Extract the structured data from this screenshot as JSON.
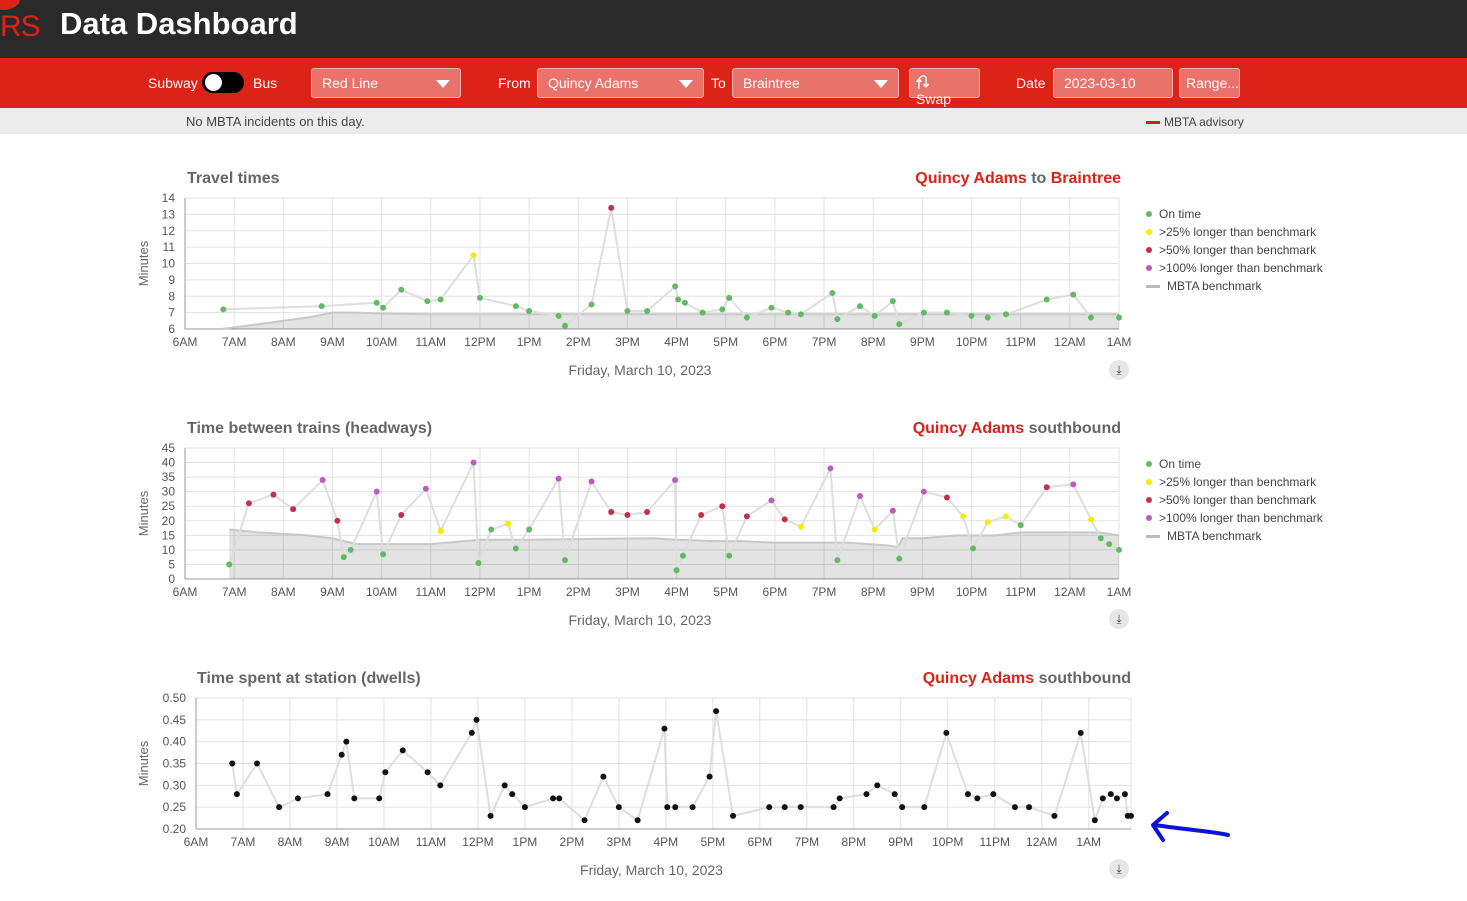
{
  "header": {
    "logo_text": "RS",
    "title": "Data Dashboard"
  },
  "controls": {
    "subway_label": "Subway",
    "bus_label": "Bus",
    "line": "Red Line",
    "from_label": "From",
    "from_value": "Quincy Adams",
    "to_label": "To",
    "to_value": "Braintree",
    "swap_label": "Swap",
    "date_label": "Date",
    "date_value": "2023-03-10",
    "range_label": "Range..."
  },
  "infobar": {
    "message": "No MBTA incidents on this day.",
    "advisory": "MBTA advisory"
  },
  "colors": {
    "accent": "#dd2218",
    "on_time": "#64b964",
    "over25": "#f5ed00",
    "over50": "#c33149",
    "over100": "#bb5cc3",
    "benchmark": "#bbbbbb"
  },
  "legend": [
    "On time",
    ">25% longer than benchmark",
    ">50% longer than benchmark",
    ">100% longer than benchmark",
    "MBTA benchmark"
  ],
  "chart_data": [
    {
      "type": "scatter",
      "title": "Travel times",
      "station_from": "Quincy Adams",
      "connector": "to",
      "station_to": "Braintree",
      "xlabel": "Friday, March 10, 2023",
      "ylabel": "Minutes",
      "x_ticks": [
        "6AM",
        "7AM",
        "8AM",
        "9AM",
        "10AM",
        "11AM",
        "12PM",
        "1PM",
        "2PM",
        "3PM",
        "4PM",
        "5PM",
        "6PM",
        "7PM",
        "8PM",
        "9PM",
        "10PM",
        "11PM",
        "12AM",
        "1AM"
      ],
      "x_range_hours": [
        6,
        25
      ],
      "y_ticks": [
        6,
        7,
        8,
        9,
        10,
        11,
        12,
        13,
        14
      ],
      "ylim": [
        6,
        14
      ],
      "benchmark": [
        [
          6.75,
          6
        ],
        [
          7.5,
          6.3
        ],
        [
          8.5,
          6.7
        ],
        [
          9.0,
          7.0
        ],
        [
          9.5,
          7.0
        ],
        [
          10,
          6.95
        ],
        [
          11,
          6.9
        ],
        [
          14,
          6.9
        ],
        [
          18,
          6.9
        ],
        [
          22,
          6.9
        ],
        [
          25,
          6.9
        ]
      ],
      "points": [
        [
          6.78,
          7.2,
          "on"
        ],
        [
          8.78,
          7.4,
          "on"
        ],
        [
          9.9,
          7.6,
          "on"
        ],
        [
          10.03,
          7.3,
          "on"
        ],
        [
          10.4,
          8.4,
          "on"
        ],
        [
          10.93,
          7.7,
          "on"
        ],
        [
          11.2,
          7.8,
          "on"
        ],
        [
          11.87,
          10.5,
          "y"
        ],
        [
          12.0,
          7.9,
          "on"
        ],
        [
          12.73,
          7.4,
          "on"
        ],
        [
          13.0,
          7.1,
          "on"
        ],
        [
          13.6,
          6.8,
          "on"
        ],
        [
          13.73,
          6.2,
          "on"
        ],
        [
          14.27,
          7.5,
          "on"
        ],
        [
          14.67,
          13.4,
          "r"
        ],
        [
          15.0,
          7.1,
          "on"
        ],
        [
          15.4,
          7.1,
          "on"
        ],
        [
          15.97,
          8.6,
          "on"
        ],
        [
          16.03,
          7.8,
          "on"
        ],
        [
          16.17,
          7.6,
          "on"
        ],
        [
          16.53,
          7.0,
          "on"
        ],
        [
          16.93,
          7.2,
          "on"
        ],
        [
          17.07,
          7.9,
          "on"
        ],
        [
          17.43,
          6.7,
          "on"
        ],
        [
          17.93,
          7.3,
          "on"
        ],
        [
          18.27,
          7.0,
          "on"
        ],
        [
          18.53,
          6.9,
          "on"
        ],
        [
          19.17,
          8.2,
          "on"
        ],
        [
          19.27,
          6.6,
          "on"
        ],
        [
          19.73,
          7.4,
          "on"
        ],
        [
          20.03,
          6.8,
          "on"
        ],
        [
          20.4,
          7.7,
          "on"
        ],
        [
          20.53,
          6.3,
          "on"
        ],
        [
          21.03,
          7.0,
          "on"
        ],
        [
          21.5,
          7.0,
          "on"
        ],
        [
          22.0,
          6.8,
          "on"
        ],
        [
          22.33,
          6.7,
          "on"
        ],
        [
          22.7,
          6.9,
          "on"
        ],
        [
          23.53,
          7.8,
          "on"
        ],
        [
          24.07,
          8.1,
          "on"
        ],
        [
          24.43,
          6.7,
          "on"
        ],
        [
          25.0,
          6.7,
          "on"
        ]
      ]
    },
    {
      "type": "scatter",
      "title": "Time between trains (headways)",
      "station_from": "Quincy Adams",
      "direction": "southbound",
      "xlabel": "Friday, March 10, 2023",
      "ylabel": "Minutes",
      "x_ticks": [
        "6AM",
        "7AM",
        "8AM",
        "9AM",
        "10AM",
        "11AM",
        "12PM",
        "1PM",
        "2PM",
        "3PM",
        "4PM",
        "5PM",
        "6PM",
        "7PM",
        "8PM",
        "9PM",
        "10PM",
        "11PM",
        "12AM",
        "1AM"
      ],
      "x_range_hours": [
        6,
        25
      ],
      "y_ticks": [
        0,
        5,
        10,
        15,
        20,
        25,
        30,
        35,
        40,
        45
      ],
      "ylim": [
        0,
        45
      ],
      "benchmark": [
        [
          6.9,
          17
        ],
        [
          7.5,
          16
        ],
        [
          8.5,
          15
        ],
        [
          9.0,
          14
        ],
        [
          9.5,
          12
        ],
        [
          10.5,
          12
        ],
        [
          11,
          12
        ],
        [
          12,
          13.5
        ],
        [
          13,
          13.5
        ],
        [
          15.5,
          14
        ],
        [
          16,
          13.5
        ],
        [
          16.8,
          13
        ],
        [
          17.3,
          13
        ],
        [
          18,
          12.5
        ],
        [
          19,
          12.5
        ],
        [
          19.5,
          12.5
        ],
        [
          19.9,
          12
        ],
        [
          20.3,
          11.5
        ],
        [
          20.5,
          11
        ],
        [
          20.6,
          14
        ],
        [
          21,
          14
        ],
        [
          21.7,
          15
        ],
        [
          22.5,
          15
        ],
        [
          23,
          16
        ],
        [
          24,
          16
        ],
        [
          24.6,
          16
        ],
        [
          25,
          15
        ]
      ],
      "benchmark_start": 6.9,
      "points": [
        [
          6.9,
          5,
          "on"
        ],
        [
          7.3,
          26,
          "r"
        ],
        [
          7.8,
          29,
          "r"
        ],
        [
          8.2,
          24,
          "r"
        ],
        [
          8.8,
          34,
          "p"
        ],
        [
          9.1,
          20,
          "r"
        ],
        [
          9.23,
          7.5,
          "on"
        ],
        [
          9.37,
          10,
          "on"
        ],
        [
          9.9,
          30,
          "p"
        ],
        [
          10.03,
          8.5,
          "on"
        ],
        [
          10.4,
          22,
          "r"
        ],
        [
          10.9,
          31,
          "p"
        ],
        [
          11.2,
          16.5,
          "y"
        ],
        [
          11.87,
          40,
          "p"
        ],
        [
          11.97,
          5.5,
          "on"
        ],
        [
          12.23,
          17,
          "on"
        ],
        [
          12.57,
          19,
          "y"
        ],
        [
          12.73,
          10.5,
          "on"
        ],
        [
          13.0,
          17,
          "on"
        ],
        [
          13.6,
          34.5,
          "p"
        ],
        [
          13.73,
          6.5,
          "on"
        ],
        [
          14.27,
          33.5,
          "p"
        ],
        [
          14.67,
          23,
          "r"
        ],
        [
          15.0,
          22,
          "r"
        ],
        [
          15.4,
          23,
          "r"
        ],
        [
          15.97,
          34,
          "p"
        ],
        [
          16.0,
          3,
          "on"
        ],
        [
          16.13,
          8,
          "on"
        ],
        [
          16.5,
          22,
          "r"
        ],
        [
          16.93,
          25,
          "r"
        ],
        [
          17.07,
          8,
          "on"
        ],
        [
          17.43,
          21.5,
          "r"
        ],
        [
          17.93,
          27,
          "p"
        ],
        [
          18.2,
          20.5,
          "r"
        ],
        [
          18.53,
          18,
          "y"
        ],
        [
          19.13,
          38,
          "p"
        ],
        [
          19.27,
          6.5,
          "on"
        ],
        [
          19.73,
          28.5,
          "p"
        ],
        [
          20.03,
          17,
          "y"
        ],
        [
          20.4,
          23.5,
          "p"
        ],
        [
          20.53,
          7,
          "on"
        ],
        [
          21.03,
          30,
          "p"
        ],
        [
          21.5,
          28,
          "r"
        ],
        [
          21.83,
          21.5,
          "y"
        ],
        [
          22.03,
          10.5,
          "on"
        ],
        [
          22.33,
          19.5,
          "y"
        ],
        [
          22.7,
          21.5,
          "y"
        ],
        [
          23.0,
          18.5,
          "on"
        ],
        [
          23.53,
          31.5,
          "r"
        ],
        [
          24.07,
          32.5,
          "p"
        ],
        [
          24.43,
          20.5,
          "y"
        ],
        [
          24.63,
          14,
          "on"
        ],
        [
          24.8,
          12,
          "on"
        ],
        [
          25.0,
          10,
          "on"
        ]
      ]
    },
    {
      "type": "line",
      "title": "Time spent at station (dwells)",
      "station_from": "Quincy Adams",
      "direction": "southbound",
      "xlabel": "Friday, March 10, 2023",
      "ylabel": "Minutes",
      "x_ticks": [
        "6AM",
        "7AM",
        "8AM",
        "9AM",
        "10AM",
        "11AM",
        "12PM",
        "1PM",
        "2PM",
        "3PM",
        "4PM",
        "5PM",
        "6PM",
        "7PM",
        "8PM",
        "9PM",
        "10PM",
        "11PM",
        "12AM",
        "1AM"
      ],
      "x_range_hours": [
        6,
        25.9
      ],
      "y_ticks": [
        "0.20",
        "0.25",
        "0.30",
        "0.35",
        "0.40",
        "0.45",
        "0.50"
      ],
      "ylim": [
        0.2,
        0.5
      ],
      "points": [
        [
          6.77,
          0.35
        ],
        [
          6.87,
          0.28
        ],
        [
          7.3,
          0.35
        ],
        [
          7.77,
          0.25
        ],
        [
          8.17,
          0.27
        ],
        [
          8.8,
          0.28
        ],
        [
          9.1,
          0.37
        ],
        [
          9.2,
          0.4
        ],
        [
          9.37,
          0.27
        ],
        [
          9.9,
          0.27
        ],
        [
          10.03,
          0.33
        ],
        [
          10.4,
          0.38
        ],
        [
          10.93,
          0.33
        ],
        [
          11.2,
          0.3
        ],
        [
          11.87,
          0.42
        ],
        [
          11.97,
          0.45
        ],
        [
          12.27,
          0.23
        ],
        [
          12.57,
          0.3
        ],
        [
          12.73,
          0.28
        ],
        [
          13.0,
          0.25
        ],
        [
          13.6,
          0.27
        ],
        [
          13.73,
          0.27
        ],
        [
          14.27,
          0.22
        ],
        [
          14.67,
          0.32
        ],
        [
          15.0,
          0.25
        ],
        [
          15.4,
          0.22
        ],
        [
          15.97,
          0.43
        ],
        [
          16.03,
          0.25
        ],
        [
          16.2,
          0.25
        ],
        [
          16.57,
          0.25
        ],
        [
          16.93,
          0.32
        ],
        [
          17.07,
          0.47
        ],
        [
          17.43,
          0.23
        ],
        [
          18.2,
          0.25
        ],
        [
          18.53,
          0.25
        ],
        [
          18.87,
          0.25
        ],
        [
          19.57,
          0.25
        ],
        [
          19.7,
          0.27
        ],
        [
          20.27,
          0.28
        ],
        [
          20.5,
          0.3
        ],
        [
          20.87,
          0.28
        ],
        [
          21.03,
          0.25
        ],
        [
          21.5,
          0.25
        ],
        [
          21.97,
          0.42
        ],
        [
          22.43,
          0.28
        ],
        [
          22.63,
          0.27
        ],
        [
          22.97,
          0.28
        ],
        [
          23.43,
          0.25
        ],
        [
          23.73,
          0.25
        ],
        [
          24.27,
          0.23
        ],
        [
          24.83,
          0.42
        ],
        [
          25.13,
          0.22
        ],
        [
          25.3,
          0.27
        ],
        [
          25.47,
          0.28
        ],
        [
          25.6,
          0.27
        ],
        [
          25.77,
          0.28
        ],
        [
          25.83,
          0.23
        ],
        [
          25.9,
          0.23
        ]
      ]
    }
  ]
}
